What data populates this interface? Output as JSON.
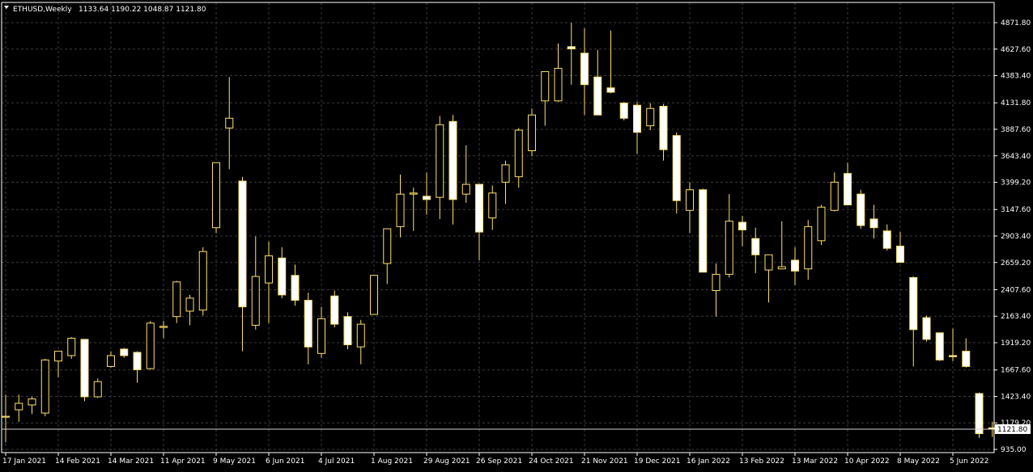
{
  "header": {
    "symbol": "ETHUSD,Weekly",
    "ohlc": "1133.64 1190.22 1048.87 1121.80"
  },
  "colors": {
    "background": "#000000",
    "grid": "#3a3a3a",
    "bull_body": "#000000",
    "bear_body": "#ffffff",
    "wick": "#ffe066",
    "text": "#ffffff",
    "price_line": "#cfcfcf"
  },
  "chart_data": {
    "type": "candlestick",
    "y_range": [
      935.0,
      4871.8
    ],
    "y_ticks": [
      "4871.80",
      "4627.60",
      "4383.40",
      "4131.80",
      "3887.60",
      "3643.40",
      "3399.20",
      "3147.60",
      "2903.40",
      "2659.20",
      "2407.60",
      "2163.40",
      "1919.20",
      "1667.60",
      "1423.40",
      "1179.20",
      "935.00"
    ],
    "current_price": "1121.80",
    "x_labels": [
      {
        "i": 0,
        "text": "17 Jan 2021"
      },
      {
        "i": 4,
        "text": "14 Feb 2021"
      },
      {
        "i": 8,
        "text": "14 Mar 2021"
      },
      {
        "i": 12,
        "text": "11 Apr 2021"
      },
      {
        "i": 16,
        "text": "9 May 2021"
      },
      {
        "i": 20,
        "text": "6 Jun 2021"
      },
      {
        "i": 24,
        "text": "4 Jul 2021"
      },
      {
        "i": 28,
        "text": "1 Aug 2021"
      },
      {
        "i": 32,
        "text": "29 Aug 2021"
      },
      {
        "i": 36,
        "text": "26 Sep 2021"
      },
      {
        "i": 40,
        "text": "24 Oct 2021"
      },
      {
        "i": 44,
        "text": "21 Nov 2021"
      },
      {
        "i": 48,
        "text": "19 Dec 2021"
      },
      {
        "i": 52,
        "text": "16 Jan 2022"
      },
      {
        "i": 56,
        "text": "13 Feb 2022"
      },
      {
        "i": 60,
        "text": "13 Mar 2022"
      },
      {
        "i": 64,
        "text": "10 Apr 2022"
      },
      {
        "i": 68,
        "text": "8 May 2022"
      },
      {
        "i": 72,
        "text": "5 Jun 2022"
      }
    ],
    "candles": [
      {
        "o": 1232,
        "h": 1440,
        "l": 1000,
        "c": 1240
      },
      {
        "o": 1300,
        "h": 1440,
        "l": 1190,
        "c": 1360
      },
      {
        "o": 1345,
        "h": 1420,
        "l": 1260,
        "c": 1400
      },
      {
        "o": 1270,
        "h": 1770,
        "l": 1240,
        "c": 1760
      },
      {
        "o": 1750,
        "h": 1840,
        "l": 1600,
        "c": 1840
      },
      {
        "o": 1800,
        "h": 1970,
        "l": 1770,
        "c": 1960
      },
      {
        "o": 1950,
        "h": 1950,
        "l": 1380,
        "c": 1420
      },
      {
        "o": 1420,
        "h": 1590,
        "l": 1410,
        "c": 1560
      },
      {
        "o": 1700,
        "h": 1840,
        "l": 1690,
        "c": 1800
      },
      {
        "o": 1860,
        "h": 1870,
        "l": 1780,
        "c": 1800
      },
      {
        "o": 1830,
        "h": 1840,
        "l": 1550,
        "c": 1670
      },
      {
        "o": 1680,
        "h": 2120,
        "l": 1670,
        "c": 2100
      },
      {
        "o": 2060,
        "h": 2120,
        "l": 1960,
        "c": 2070
      },
      {
        "o": 2160,
        "h": 2490,
        "l": 2100,
        "c": 2480
      },
      {
        "o": 2210,
        "h": 2360,
        "l": 2080,
        "c": 2330
      },
      {
        "o": 2220,
        "h": 2800,
        "l": 2170,
        "c": 2760
      },
      {
        "o": 2980,
        "h": 3560,
        "l": 2930,
        "c": 3580
      },
      {
        "o": 3900,
        "h": 4370,
        "l": 3520,
        "c": 3990
      },
      {
        "o": 3410,
        "h": 3450,
        "l": 1840,
        "c": 2250
      },
      {
        "o": 2080,
        "h": 2900,
        "l": 2040,
        "c": 2530
      },
      {
        "o": 2470,
        "h": 2850,
        "l": 2100,
        "c": 2720
      },
      {
        "o": 2700,
        "h": 2800,
        "l": 2330,
        "c": 2360
      },
      {
        "o": 2540,
        "h": 2640,
        "l": 2260,
        "c": 2310
      },
      {
        "o": 2310,
        "h": 2380,
        "l": 1720,
        "c": 1880
      },
      {
        "o": 1820,
        "h": 2250,
        "l": 1780,
        "c": 2140
      },
      {
        "o": 2350,
        "h": 2400,
        "l": 2060,
        "c": 2090
      },
      {
        "o": 2160,
        "h": 2200,
        "l": 1860,
        "c": 1900
      },
      {
        "o": 1880,
        "h": 2130,
        "l": 1720,
        "c": 2090
      },
      {
        "o": 2180,
        "h": 2500,
        "l": 2180,
        "c": 2540
      },
      {
        "o": 2650,
        "h": 2960,
        "l": 2460,
        "c": 2970
      },
      {
        "o": 2990,
        "h": 3470,
        "l": 2890,
        "c": 3290
      },
      {
        "o": 3290,
        "h": 3350,
        "l": 2950,
        "c": 3300
      },
      {
        "o": 3270,
        "h": 3490,
        "l": 3100,
        "c": 3240
      },
      {
        "o": 3260,
        "h": 4010,
        "l": 3060,
        "c": 3930
      },
      {
        "o": 3960,
        "h": 4020,
        "l": 3010,
        "c": 3240
      },
      {
        "o": 3290,
        "h": 3740,
        "l": 3210,
        "c": 3380
      },
      {
        "o": 3380,
        "h": 3360,
        "l": 2680,
        "c": 2940
      },
      {
        "o": 3070,
        "h": 3370,
        "l": 2960,
        "c": 3300
      },
      {
        "o": 3400,
        "h": 3600,
        "l": 3200,
        "c": 3560
      },
      {
        "o": 3450,
        "h": 3900,
        "l": 3350,
        "c": 3880
      },
      {
        "o": 3690,
        "h": 4080,
        "l": 3640,
        "c": 4020
      },
      {
        "o": 4150,
        "h": 4400,
        "l": 3920,
        "c": 4420
      },
      {
        "o": 4150,
        "h": 4680,
        "l": 4140,
        "c": 4450
      },
      {
        "o": 4650,
        "h": 4870,
        "l": 4300,
        "c": 4630
      },
      {
        "o": 4590,
        "h": 4820,
        "l": 4020,
        "c": 4300
      },
      {
        "o": 4370,
        "h": 4620,
        "l": 4040,
        "c": 4020
      },
      {
        "o": 4270,
        "h": 4800,
        "l": 4220,
        "c": 4230
      },
      {
        "o": 4130,
        "h": 4140,
        "l": 3970,
        "c": 3990
      },
      {
        "o": 4110,
        "h": 4140,
        "l": 3660,
        "c": 3860
      },
      {
        "o": 3920,
        "h": 4130,
        "l": 3880,
        "c": 4080
      },
      {
        "o": 4100,
        "h": 4120,
        "l": 3600,
        "c": 3700
      },
      {
        "o": 3830,
        "h": 3860,
        "l": 3110,
        "c": 3230
      },
      {
        "o": 3140,
        "h": 3400,
        "l": 2930,
        "c": 3330
      },
      {
        "o": 3330,
        "h": 3340,
        "l": 2570,
        "c": 2570
      },
      {
        "o": 2400,
        "h": 2650,
        "l": 2160,
        "c": 2550
      },
      {
        "o": 2550,
        "h": 3290,
        "l": 2520,
        "c": 3040
      },
      {
        "o": 3030,
        "h": 3090,
        "l": 2810,
        "c": 2960
      },
      {
        "o": 2880,
        "h": 2980,
        "l": 2560,
        "c": 2730
      },
      {
        "o": 2590,
        "h": 2680,
        "l": 2290,
        "c": 2730
      },
      {
        "o": 2600,
        "h": 3040,
        "l": 2600,
        "c": 2620
      },
      {
        "o": 2680,
        "h": 2800,
        "l": 2450,
        "c": 2580
      },
      {
        "o": 2600,
        "h": 3050,
        "l": 2500,
        "c": 2990
      },
      {
        "o": 2860,
        "h": 3190,
        "l": 2820,
        "c": 3170
      },
      {
        "o": 3140,
        "h": 3490,
        "l": 3130,
        "c": 3400
      },
      {
        "o": 3480,
        "h": 3580,
        "l": 3230,
        "c": 3190
      },
      {
        "o": 3290,
        "h": 3330,
        "l": 2970,
        "c": 3000
      },
      {
        "o": 3060,
        "h": 3190,
        "l": 2880,
        "c": 2980
      },
      {
        "o": 2950,
        "h": 3010,
        "l": 2770,
        "c": 2790
      },
      {
        "o": 2810,
        "h": 2940,
        "l": 2660,
        "c": 2660
      },
      {
        "o": 2520,
        "h": 2530,
        "l": 1700,
        "c": 2040
      },
      {
        "o": 2150,
        "h": 2170,
        "l": 1930,
        "c": 1950
      },
      {
        "o": 2010,
        "h": 2010,
        "l": 1750,
        "c": 1760
      },
      {
        "o": 1800,
        "h": 2050,
        "l": 1750,
        "c": 1790
      },
      {
        "o": 1840,
        "h": 1960,
        "l": 1690,
        "c": 1700
      },
      {
        "o": 1450,
        "h": 1460,
        "l": 1040,
        "c": 1080
      },
      {
        "o": 1133.64,
        "h": 1190.22,
        "l": 1048.87,
        "c": 1121.8
      }
    ]
  }
}
